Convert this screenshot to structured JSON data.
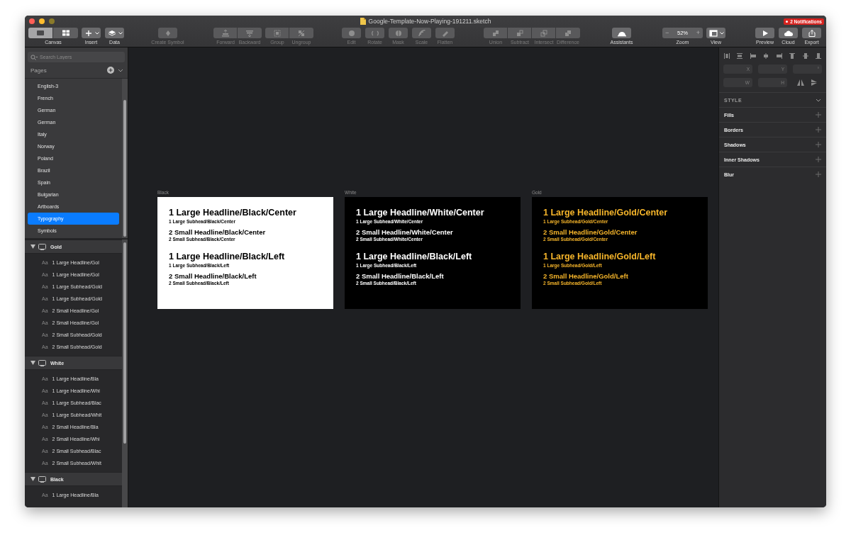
{
  "window": {
    "title": "Google-Template-Now-Playing-191211.sketch",
    "notification": "2 Notifications"
  },
  "toolbar": [
    {
      "kind": "view-switch",
      "segments": [
        {
          "selected": true
        },
        {
          "selected": false
        }
      ],
      "items": [
        {
          "label": "Canvas",
          "disabled": false
        }
      ]
    },
    {
      "kind": "menu",
      "items": [
        {
          "label": "Insert",
          "disabled": false
        }
      ]
    },
    {
      "kind": "menu",
      "items": [
        {
          "label": "Data",
          "disabled": false
        }
      ]
    },
    {
      "kind": "single",
      "items": [
        {
          "label": "Create Symbol",
          "disabled": true
        }
      ]
    },
    {
      "kind": "segmented",
      "items": [
        {
          "label": "Forward",
          "disabled": true
        },
        {
          "label": "Backward",
          "disabled": true
        }
      ]
    },
    {
      "kind": "segmented",
      "items": [
        {
          "label": "Group",
          "disabled": true
        },
        {
          "label": "Ungroup",
          "disabled": true
        }
      ]
    },
    {
      "kind": "single",
      "items": [
        {
          "label": "Edit",
          "disabled": true
        }
      ]
    },
    {
      "kind": "single",
      "items": [
        {
          "label": "Rotate",
          "disabled": true
        }
      ]
    },
    {
      "kind": "single",
      "items": [
        {
          "label": "Mask",
          "disabled": true
        }
      ]
    },
    {
      "kind": "single",
      "items": [
        {
          "label": "Scale",
          "disabled": true
        }
      ]
    },
    {
      "kind": "single",
      "items": [
        {
          "label": "Flatten",
          "disabled": true
        }
      ]
    },
    {
      "kind": "segmented",
      "items": [
        {
          "label": "Union",
          "disabled": true
        },
        {
          "label": "Subtract",
          "disabled": true
        },
        {
          "label": "Intersect",
          "disabled": true
        },
        {
          "label": "Difference",
          "disabled": true
        }
      ]
    },
    {
      "kind": "single",
      "items": [
        {
          "label": "Assistants",
          "disabled": false
        }
      ]
    },
    {
      "kind": "zoom",
      "minus": "−",
      "value": "52%",
      "plus": "+",
      "items": [
        {
          "label": "Zoom",
          "disabled": false
        }
      ]
    },
    {
      "kind": "menu",
      "items": [
        {
          "label": "View",
          "disabled": false
        }
      ]
    },
    {
      "kind": "single",
      "items": [
        {
          "label": "Preview",
          "disabled": false
        }
      ]
    },
    {
      "kind": "single",
      "items": [
        {
          "label": "Cloud",
          "disabled": false
        }
      ]
    },
    {
      "kind": "single",
      "items": [
        {
          "label": "Export",
          "disabled": false
        }
      ]
    }
  ],
  "sidebar": {
    "search": {
      "placeholder": "Search Layers"
    },
    "pages_title": "Pages",
    "pages": [
      {
        "label": "English-3",
        "selected": false
      },
      {
        "label": "French",
        "selected": false
      },
      {
        "label": "German",
        "selected": false
      },
      {
        "label": "German",
        "selected": false
      },
      {
        "label": "Italy",
        "selected": false
      },
      {
        "label": "Norway",
        "selected": false
      },
      {
        "label": "Poland",
        "selected": false
      },
      {
        "label": "Brazil",
        "selected": false
      },
      {
        "label": "Spain",
        "selected": false
      },
      {
        "label": "Bulgarian",
        "selected": false
      },
      {
        "label": "Artboards",
        "selected": false
      },
      {
        "label": "Typography",
        "selected": true
      },
      {
        "label": "Symbols",
        "selected": false
      }
    ],
    "layers": [
      {
        "label": "Gold",
        "expanded": true,
        "children": [
          {
            "prefix": "Aa",
            "label": "1 Large Headline/Gol"
          },
          {
            "prefix": "Aa",
            "label": "1 Large Headline/Gol"
          },
          {
            "prefix": "Aa",
            "label": "1 Large Subhead/Gold"
          },
          {
            "prefix": "Aa",
            "label": "1 Large Subhead/Gold"
          },
          {
            "prefix": "Aa",
            "label": "2 Small Headline/Gol"
          },
          {
            "prefix": "Aa",
            "label": "2 Small Headline/Gol"
          },
          {
            "prefix": "Aa",
            "label": "2 Small Subhead/Gold"
          },
          {
            "prefix": "Aa",
            "label": "2 Small Subhead/Gold"
          }
        ]
      },
      {
        "label": "White",
        "expanded": true,
        "children": [
          {
            "prefix": "Aa",
            "label": "1 Large Headline/Bla"
          },
          {
            "prefix": "Aa",
            "label": "1 Large Headline/Whi"
          },
          {
            "prefix": "Aa",
            "label": "1 Large Subhead/Blac"
          },
          {
            "prefix": "Aa",
            "label": "1 Large Subhead/Whit"
          },
          {
            "prefix": "Aa",
            "label": "2 Small Headline/Bla"
          },
          {
            "prefix": "Aa",
            "label": "2 Small Headline/Whi"
          },
          {
            "prefix": "Aa",
            "label": "2 Small Subhead/Blac"
          },
          {
            "prefix": "Aa",
            "label": "2 Small Subhead/Whit"
          }
        ]
      },
      {
        "label": "Black",
        "expanded": true,
        "children": [
          {
            "prefix": "Aa",
            "label": "1 Large Headline/Bla"
          }
        ]
      }
    ]
  },
  "artboards": [
    {
      "label": "Black",
      "kind": "light",
      "color": "#000000",
      "blocks": [
        {
          "lines": [
            {
              "kind": "headline-large",
              "text": "1 Large Headline/Black/Center"
            },
            {
              "kind": "subhead-large",
              "text": "1 Large Subhead/Black/Center"
            },
            {
              "kind": "headline-small",
              "text": "2 Small Headline/Black/Center"
            },
            {
              "kind": "subhead-small",
              "text": "2 Small Subhead/Black/Center"
            }
          ]
        },
        {
          "lines": [
            {
              "kind": "headline-large",
              "text": "1 Large Headline/Black/Left"
            },
            {
              "kind": "subhead-large",
              "text": "1 Large Subhead/Black/Left"
            },
            {
              "kind": "headline-small",
              "text": "2 Small Headline/Black/Left"
            },
            {
              "kind": "subhead-small",
              "text": "2 Small Subhead/Black/Left"
            }
          ]
        }
      ]
    },
    {
      "label": "White",
      "kind": "dark",
      "color": "#ffffff",
      "blocks": [
        {
          "lines": [
            {
              "kind": "headline-large",
              "text": "1 Large Headline/White/Center"
            },
            {
              "kind": "subhead-large",
              "text": "1 Large Subhead/White/Center"
            },
            {
              "kind": "headline-small",
              "text": "2 Small Headline/White/Center"
            },
            {
              "kind": "subhead-small",
              "text": "2 Small Subhead/White/Center"
            }
          ]
        },
        {
          "lines": [
            {
              "kind": "headline-large",
              "text": "1 Large Headline/Black/Left"
            },
            {
              "kind": "subhead-large",
              "text": "1 Large Subhead/Black/Left"
            },
            {
              "kind": "headline-small",
              "text": "2 Small Headline/Black/Left"
            },
            {
              "kind": "subhead-small",
              "text": "2 Small Subhead/Black/Left"
            }
          ]
        }
      ]
    },
    {
      "label": "Gold",
      "kind": "dark",
      "color": "#f6b52a",
      "blocks": [
        {
          "lines": [
            {
              "kind": "headline-large",
              "text": "1 Large Headline/Gold/Center"
            },
            {
              "kind": "subhead-large",
              "text": "1 Large Subhead/Gold/Center"
            },
            {
              "kind": "headline-small",
              "text": "2 Small Headline/Gold/Center"
            },
            {
              "kind": "subhead-small",
              "text": "2 Small Subhead/Gold/Center"
            }
          ]
        },
        {
          "lines": [
            {
              "kind": "headline-large",
              "text": "1 Large Headline/Gold/Left"
            },
            {
              "kind": "subhead-large",
              "text": "1 Large Subhead/Gold/Left"
            },
            {
              "kind": "headline-small",
              "text": "2 Small Headline/Gold/Left"
            },
            {
              "kind": "subhead-small",
              "text": "2 Small Subhead/Gold/Left"
            }
          ]
        }
      ]
    }
  ],
  "inspector": {
    "fields": [
      {
        "label": "X"
      },
      {
        "label": "Y"
      },
      {
        "label": "°"
      },
      {
        "label": "W"
      },
      {
        "label": "H"
      }
    ],
    "style_header": "STYLE",
    "sections": [
      "Fills",
      "Borders",
      "Shadows",
      "Inner Shadows",
      "Blur"
    ]
  }
}
